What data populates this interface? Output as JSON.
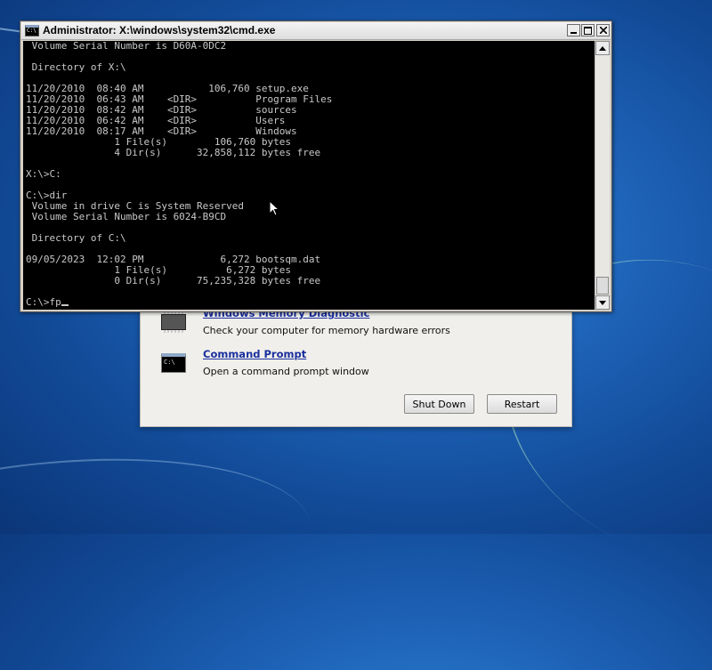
{
  "recovery_dialog": {
    "items": [
      {
        "link": "Windows Memory Diagnostic",
        "description": "Check your computer for memory hardware errors",
        "icon": "memory-chip-icon"
      },
      {
        "link": "Command Prompt",
        "description": "Open a command prompt window",
        "icon": "command-prompt-icon"
      }
    ],
    "shutdown_label": "Shut Down",
    "restart_label": "Restart"
  },
  "cmd_window": {
    "title": "Administrator: X:\\windows\\system32\\cmd.exe",
    "icon_text": "C:\\",
    "console_lines": [
      " Volume Serial Number is D60A-0DC2",
      "",
      " Directory of X:\\",
      "",
      "11/20/2010  08:40 AM           106,760 setup.exe",
      "11/20/2010  06:43 AM    <DIR>          Program Files",
      "11/20/2010  08:42 AM    <DIR>          sources",
      "11/20/2010  06:42 AM    <DIR>          Users",
      "11/20/2010  08:17 AM    <DIR>          Windows",
      "               1 File(s)        106,760 bytes",
      "               4 Dir(s)      32,858,112 bytes free",
      "",
      "X:\\>C:",
      "",
      "C:\\>dir",
      " Volume in drive C is System Reserved",
      " Volume Serial Number is 6024-B9CD",
      "",
      " Directory of C:\\",
      "",
      "09/05/2023  12:02 PM             6,272 bootsqm.dat",
      "               1 File(s)          6,272 bytes",
      "               0 Dir(s)      75,235,328 bytes free",
      ""
    ],
    "prompt": "C:\\>fp"
  },
  "colors": {
    "console_bg": "#000000",
    "console_text": "#c8c8c8",
    "link": "#1a2f9e"
  }
}
